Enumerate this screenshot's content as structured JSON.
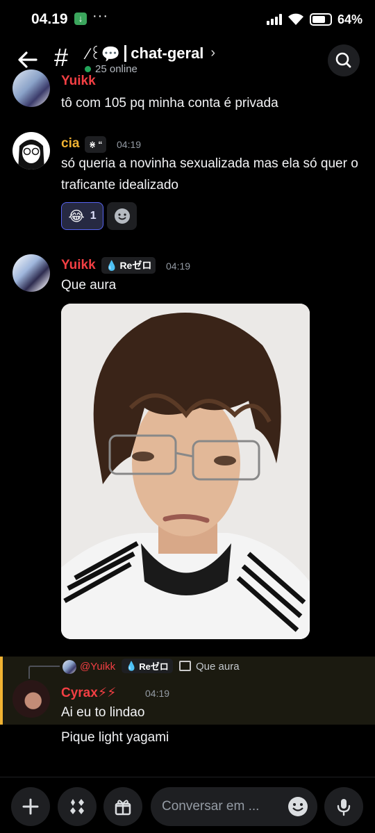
{
  "status_bar": {
    "time": "04.19",
    "battery": "64%"
  },
  "header": {
    "channel_name": "chat-geral",
    "channel_emoji": "⁄꒰💬",
    "online": "25 online"
  },
  "messages": [
    {
      "user": "Yuikk",
      "text": "tô com 105 pq minha conta é privada"
    },
    {
      "user": "cia",
      "time": "04:19",
      "text": "só queria a novinha sexualizada mas ela só quer o traficante idealizado",
      "reaction": {
        "emoji": "😂",
        "count": "1"
      }
    },
    {
      "user": "Yuikk",
      "badge": "Reゼロ",
      "time": "04:19",
      "text": "Que aura"
    },
    {
      "reply_to": {
        "user": "@Yuikk",
        "badge": "Reゼロ",
        "text": "Que aura"
      },
      "user": "Cyrax⚡⚡",
      "time": "04:19",
      "lines": [
        "Ai eu to lindao",
        "Pique light yagami"
      ]
    }
  ],
  "composer": {
    "placeholder": "Conversar em ..."
  },
  "colors": {
    "yuikk": "#f23f43",
    "cia": "#f0b232",
    "cyrax": "#f23f43",
    "mention": "#f23f43",
    "accent": "#5865f2"
  }
}
